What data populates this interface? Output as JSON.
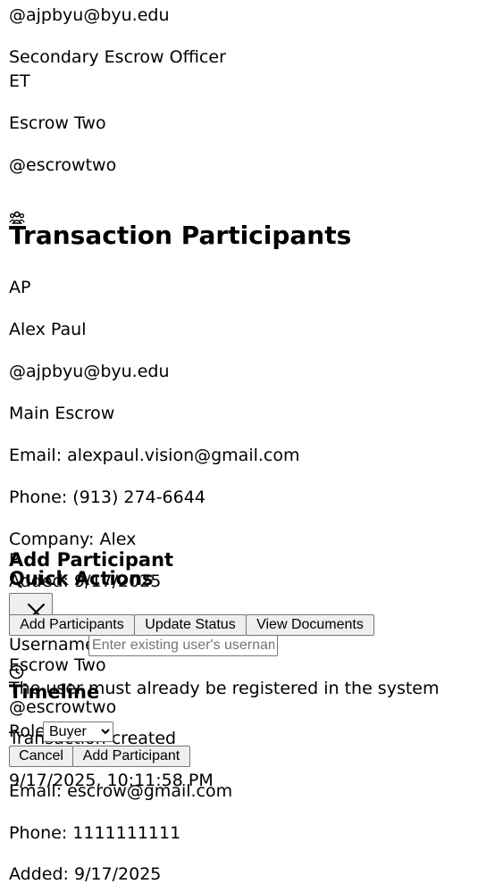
{
  "secondary_card": {
    "email_handle": "@ajpbyu@byu.edu",
    "role": "Secondary Escrow Officer",
    "initials": "ET",
    "name": "Escrow Two",
    "handle": "@escrowtwo"
  },
  "participants_section": {
    "icon": "users-icon",
    "title": "Transaction Participants"
  },
  "participant_1": {
    "initials": "AP",
    "name": "Alex Paul",
    "handle": "@ajpbyu@byu.edu",
    "role": "Main Escrow",
    "email": "Email: alexpaul.vision@gmail.com",
    "phone": "Phone: (913) 274-6644",
    "company": "Company: Alex",
    "company_cont": "P",
    "added": "Added: 9/17/2025"
  },
  "participant_2": {
    "name": "Escrow Two",
    "handle": "@escrowtwo",
    "role": "Transaction created",
    "email": "Email: escrow@gmail.com",
    "phone": "Phone: 1111111111",
    "added": "Added: 9/17/2025"
  },
  "modal": {
    "title": "Add Participant",
    "close_icon": "close-icon",
    "username_label": "Username",
    "username_placeholder": "Enter existing user's username",
    "username_hint": "The user must already be registered in the system",
    "role_label": "Role",
    "role_selected": "Buyer",
    "cancel_label": "Cancel",
    "submit_label": "Add Participant"
  },
  "quick_actions": {
    "title": "Quick Actions",
    "buttons": [
      "Add Participants",
      "Update Status",
      "View Documents"
    ]
  },
  "timeline": {
    "icon": "clock-icon",
    "title": "Timeline",
    "event": "Transaction created",
    "timestamp": "9/17/2025, 10:11:58 PM"
  }
}
